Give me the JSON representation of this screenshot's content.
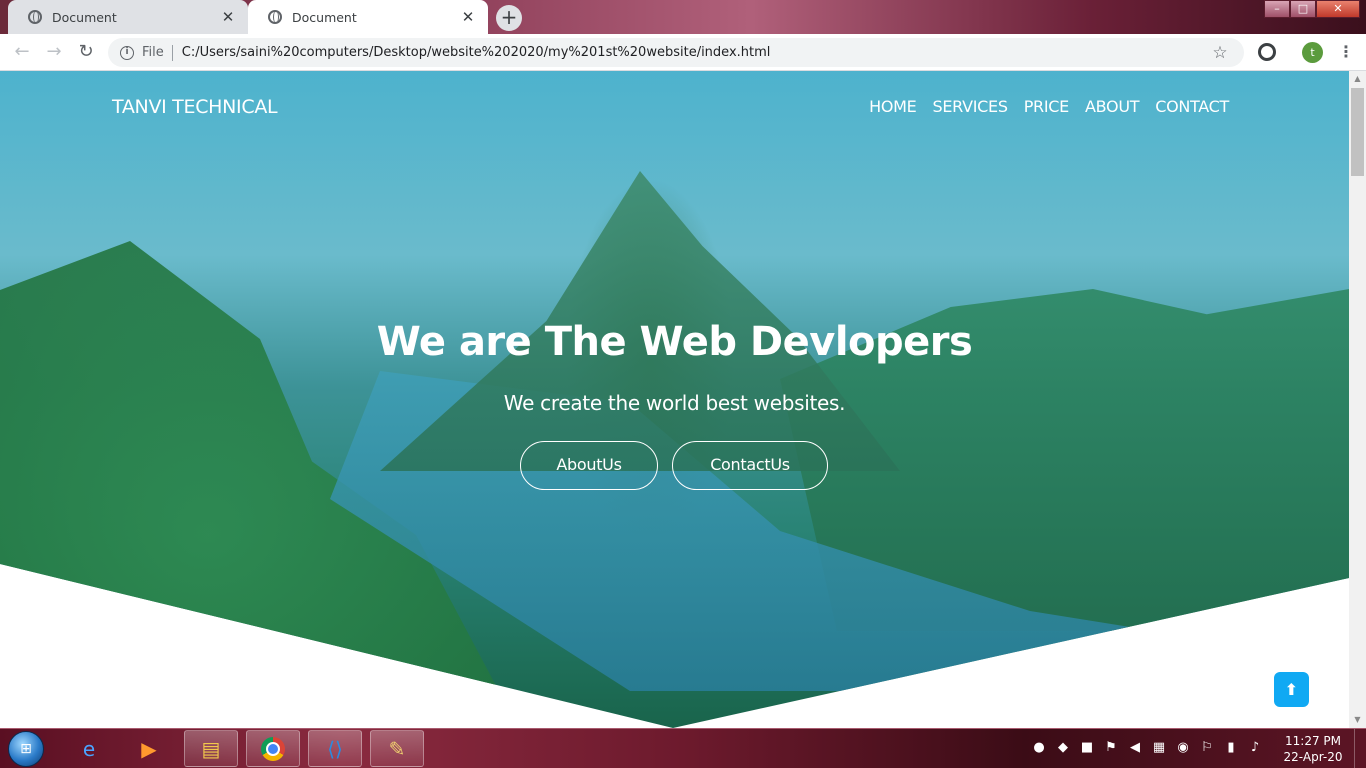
{
  "browser": {
    "tabs": [
      {
        "title": "Document"
      },
      {
        "title": "Document"
      }
    ],
    "new_tab_label": "+",
    "address": {
      "scheme": "File",
      "url": "C:/Users/saini%20computers/Desktop/website%202020/my%201st%20website/index.html"
    },
    "profile_initial": "t",
    "window_controls": {
      "minimize": "–",
      "maximize": "□",
      "close": "✕"
    }
  },
  "site": {
    "brand": "TANVI TECHNICAL",
    "nav": [
      "HOME",
      "SERVICES",
      "PRICE",
      "ABOUT",
      "CONTACT"
    ],
    "hero": {
      "title": "We are The Web Devlopers",
      "subtitle": "We create the world best websites.",
      "buttons": [
        "AboutUs",
        "ContactUs"
      ]
    },
    "scroll_top_icon": "arrow-up-icon",
    "colors": {
      "accent": "#10a9f3",
      "overlay": "#2bb3c9"
    }
  },
  "taskbar": {
    "clock_time": "11:27 PM",
    "clock_date": "22-Apr-20"
  }
}
